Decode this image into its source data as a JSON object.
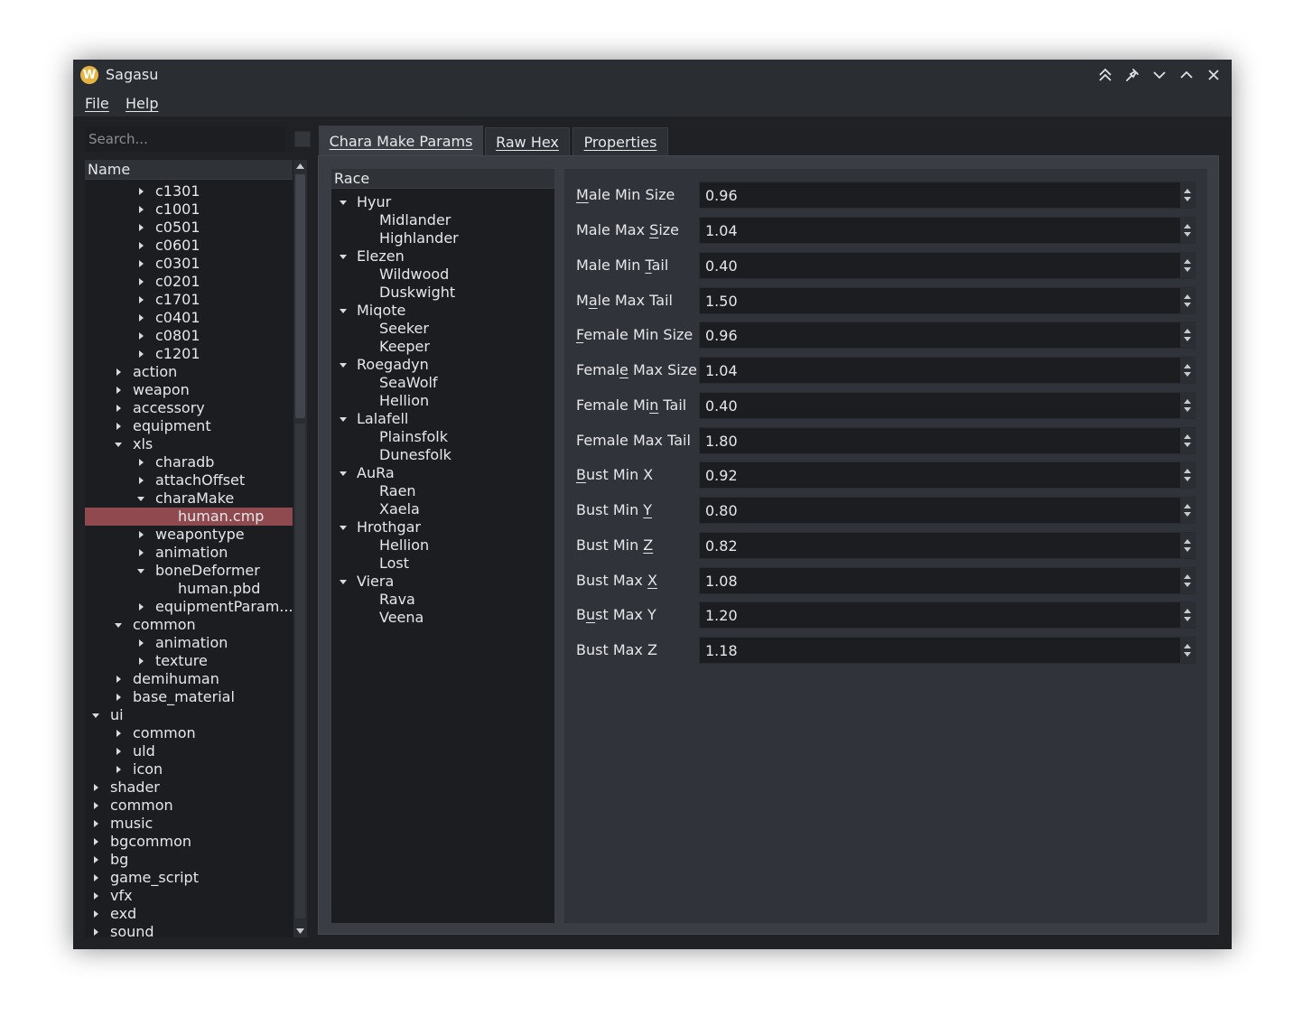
{
  "window": {
    "title": "Sagasu",
    "app_icon_letter": "W"
  },
  "menu": {
    "file": "File",
    "help": "Help"
  },
  "search": {
    "placeholder": "Search..."
  },
  "tree": {
    "header": "Name",
    "rows": [
      {
        "label": "c1301",
        "level": 2,
        "state": "collapsed"
      },
      {
        "label": "c1001",
        "level": 2,
        "state": "collapsed"
      },
      {
        "label": "c0501",
        "level": 2,
        "state": "collapsed"
      },
      {
        "label": "c0601",
        "level": 2,
        "state": "collapsed"
      },
      {
        "label": "c0301",
        "level": 2,
        "state": "collapsed"
      },
      {
        "label": "c0201",
        "level": 2,
        "state": "collapsed"
      },
      {
        "label": "c1701",
        "level": 2,
        "state": "collapsed"
      },
      {
        "label": "c0401",
        "level": 2,
        "state": "collapsed"
      },
      {
        "label": "c0801",
        "level": 2,
        "state": "collapsed"
      },
      {
        "label": "c1201",
        "level": 2,
        "state": "collapsed"
      },
      {
        "label": "action",
        "level": 1,
        "state": "collapsed"
      },
      {
        "label": "weapon",
        "level": 1,
        "state": "collapsed"
      },
      {
        "label": "accessory",
        "level": 1,
        "state": "collapsed"
      },
      {
        "label": "equipment",
        "level": 1,
        "state": "collapsed"
      },
      {
        "label": "xls",
        "level": 1,
        "state": "expanded"
      },
      {
        "label": "charadb",
        "level": 2,
        "state": "collapsed"
      },
      {
        "label": "attachOffset",
        "level": 2,
        "state": "collapsed"
      },
      {
        "label": "charaMake",
        "level": 2,
        "state": "expanded"
      },
      {
        "label": "human.cmp",
        "level": 3,
        "state": "leaf",
        "selected": true
      },
      {
        "label": "weapontype",
        "level": 2,
        "state": "collapsed"
      },
      {
        "label": "animation",
        "level": 2,
        "state": "collapsed"
      },
      {
        "label": "boneDeformer",
        "level": 2,
        "state": "expanded"
      },
      {
        "label": "human.pbd",
        "level": 3,
        "state": "leaf"
      },
      {
        "label": "equipmentParam...",
        "level": 2,
        "state": "collapsed"
      },
      {
        "label": "common",
        "level": 1,
        "state": "expanded"
      },
      {
        "label": "animation",
        "level": 2,
        "state": "collapsed"
      },
      {
        "label": "texture",
        "level": 2,
        "state": "collapsed"
      },
      {
        "label": "demihuman",
        "level": 1,
        "state": "collapsed"
      },
      {
        "label": "base_material",
        "level": 1,
        "state": "collapsed"
      },
      {
        "label": "ui",
        "level": 0,
        "state": "expanded"
      },
      {
        "label": "common",
        "level": 1,
        "state": "collapsed"
      },
      {
        "label": "uld",
        "level": 1,
        "state": "collapsed"
      },
      {
        "label": "icon",
        "level": 1,
        "state": "collapsed"
      },
      {
        "label": "shader",
        "level": 0,
        "state": "collapsed"
      },
      {
        "label": "common",
        "level": 0,
        "state": "collapsed"
      },
      {
        "label": "music",
        "level": 0,
        "state": "collapsed"
      },
      {
        "label": "bgcommon",
        "level": 0,
        "state": "collapsed"
      },
      {
        "label": "bg",
        "level": 0,
        "state": "collapsed"
      },
      {
        "label": "game_script",
        "level": 0,
        "state": "collapsed"
      },
      {
        "label": "vfx",
        "level": 0,
        "state": "collapsed"
      },
      {
        "label": "exd",
        "level": 0,
        "state": "collapsed"
      },
      {
        "label": "sound",
        "level": 0,
        "state": "collapsed"
      }
    ]
  },
  "tabs": [
    {
      "label": "Chara Make Params",
      "active": true
    },
    {
      "label": "Raw Hex",
      "active": false
    },
    {
      "label": "Properties",
      "active": false
    }
  ],
  "race_list": {
    "header": "Race",
    "rows": [
      {
        "label": "Hyur",
        "level": 0
      },
      {
        "label": "Midlander",
        "level": 1
      },
      {
        "label": "Highlander",
        "level": 1
      },
      {
        "label": "Elezen",
        "level": 0
      },
      {
        "label": "Wildwood",
        "level": 1
      },
      {
        "label": "Duskwight",
        "level": 1
      },
      {
        "label": "Miqote",
        "level": 0
      },
      {
        "label": "Seeker",
        "level": 1
      },
      {
        "label": "Keeper",
        "level": 1
      },
      {
        "label": "Roegadyn",
        "level": 0
      },
      {
        "label": "SeaWolf",
        "level": 1
      },
      {
        "label": "Hellion",
        "level": 1
      },
      {
        "label": "Lalafell",
        "level": 0
      },
      {
        "label": "Plainsfolk",
        "level": 1
      },
      {
        "label": "Dunesfolk",
        "level": 1
      },
      {
        "label": "AuRa",
        "level": 0
      },
      {
        "label": "Raen",
        "level": 1
      },
      {
        "label": "Xaela",
        "level": 1
      },
      {
        "label": "Hrothgar",
        "level": 0
      },
      {
        "label": "Hellion",
        "level": 1
      },
      {
        "label": "Lost",
        "level": 1
      },
      {
        "label": "Viera",
        "level": 0
      },
      {
        "label": "Rava",
        "level": 1
      },
      {
        "label": "Veena",
        "level": 1
      }
    ]
  },
  "params": [
    {
      "label": "Male Min Size",
      "value": "0.96",
      "mnemonic_index": 0
    },
    {
      "label": "Male Max Size",
      "value": "1.04",
      "mnemonic_index": 9
    },
    {
      "label": "Male Min Tail",
      "value": "0.40",
      "mnemonic_index": 9
    },
    {
      "label": "Male Max Tail",
      "value": "1.50",
      "mnemonic_index": 1
    },
    {
      "label": "Female Min Size",
      "value": "0.96",
      "mnemonic_index": 0
    },
    {
      "label": "Female Max Size",
      "value": "1.04",
      "mnemonic_index": 5
    },
    {
      "label": "Female Min Tail",
      "value": "0.40",
      "mnemonic_index": 9
    },
    {
      "label": "Female Max Tail",
      "value": "1.80",
      "mnemonic_index": -1
    },
    {
      "label": "Bust Min X",
      "value": "0.92",
      "mnemonic_index": 0
    },
    {
      "label": "Bust Min Y",
      "value": "0.80",
      "mnemonic_index": 9
    },
    {
      "label": "Bust Min Z",
      "value": "0.82",
      "mnemonic_index": 9
    },
    {
      "label": "Bust Max X",
      "value": "1.08",
      "mnemonic_index": 9
    },
    {
      "label": "Bust Max Y",
      "value": "1.20",
      "mnemonic_index": 1
    },
    {
      "label": "Bust Max Z",
      "value": "1.18",
      "mnemonic_index": -1
    }
  ],
  "colors": {
    "selection": "#8e4a4e",
    "window_bg": "#292c31",
    "panel_bg": "#3a3d43",
    "field_bg": "#1b1d20",
    "text": "#e6e7e9",
    "app_icon": "#e6b341"
  }
}
